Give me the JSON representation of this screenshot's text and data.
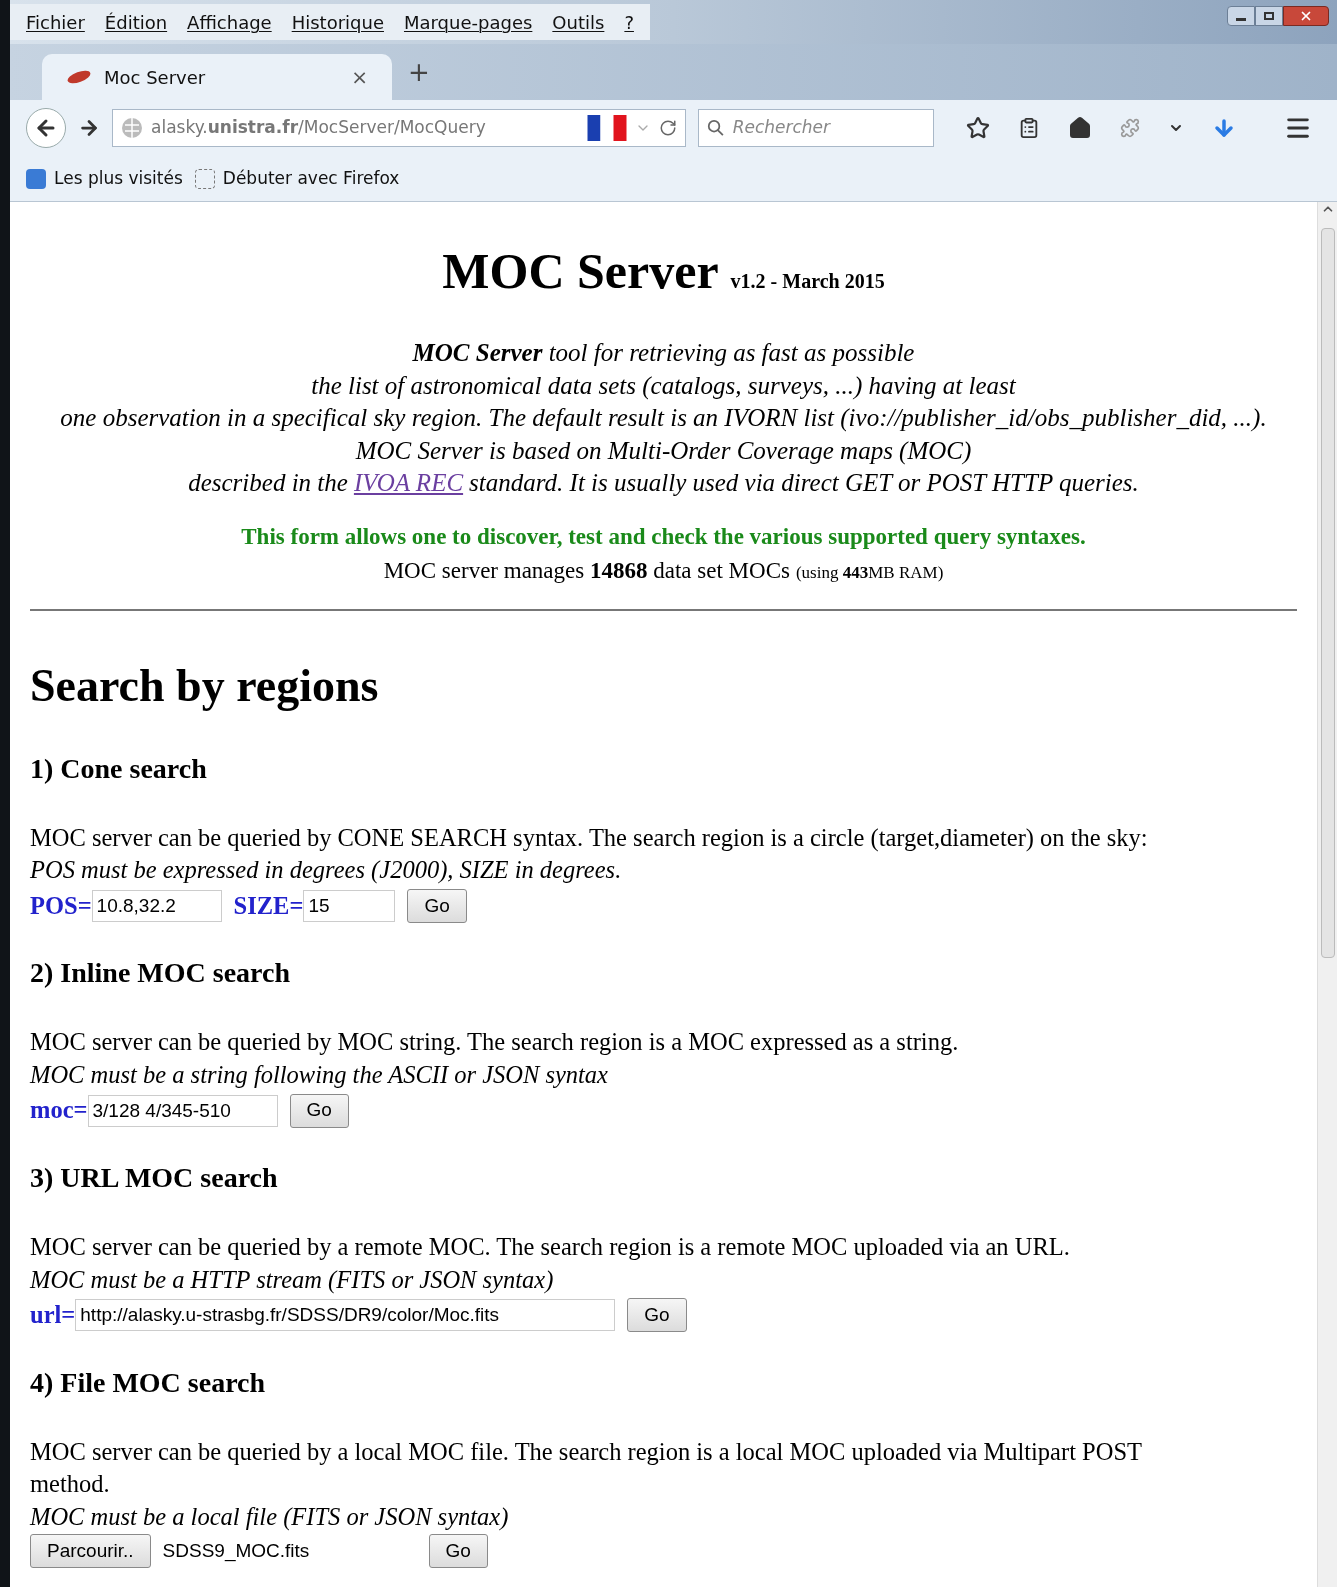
{
  "menu": [
    "Fichier",
    "Édition",
    "Affichage",
    "Historique",
    "Marque-pages",
    "Outils",
    "?"
  ],
  "tabs": [
    {
      "title": "Moc Server",
      "close": "×",
      "selected": true
    }
  ],
  "new_tab": "+",
  "url": "alasky.**unistra.fr**/MocServer/MocQuery",
  "search": {
    "placeholder": "Rechercher"
  },
  "bookmarks": [
    "Les plus visités",
    "Débuter avec Firefox"
  ],
  "page": {
    "title": "MOC Server",
    "version": "v1.2 - March 2015",
    "intro": [
      "**MOC Server** tool for retrieving as fast as possible",
      "the list of astronomical data sets (catalogs, surveys, ...) having at least",
      "one observation in a specifical sky region. The default result is an IVORN list (ivo://publisher_id/obs_publisher_did, ...).",
      "MOC Server is based on Multi-Order Coverage maps (MOC)"
    ],
    "intro_last": {
      "before": "described in the",
      "link": "IVOA REC",
      "after": "standard. It is usually used via direct GET or POST HTTP queries."
    },
    "notice": "This form allows one to discover, test and check the various supported query syntaxes.",
    "stats": "MOC server manages **14868** data set MOCs",
    "stats_note": "(using **443**MB RAM)",
    "heading": "Search by regions",
    "sections": [
      {
        "kind": "inputs",
        "title": "1) Cone search",
        "description": "MOC server can be queried by CONE SEARCH syntax. The search region is a circle (target,diameter) on the sky:",
        "hint": "POS must be expressed in degrees (J2000), SIZE in degrees.",
        "fields": [
          {
            "label": "POS=",
            "value": "10.8,32.2"
          },
          {
            "label": "SIZE=",
            "value": "15"
          }
        ],
        "button": "Go"
      },
      {
        "kind": "inputs",
        "title": "2) Inline MOC search",
        "description": "MOC server can be queried by MOC string. The search region is a MOC expressed as a string.",
        "hint": "MOC must be a string following the ASCII or JSON syntax",
        "fields": [
          {
            "label": "moc=",
            "value": "3/128 4/345-510"
          }
        ],
        "button": "Go"
      },
      {
        "kind": "inputs",
        "title": "3) URL MOC search",
        "description": "MOC server can be queried by a remote MOC. The search region is a remote MOC uploaded via an URL.",
        "hint": "MOC must be a HTTP stream (FITS or JSON syntax)",
        "fields": [
          {
            "label": "url=",
            "value": "http://alasky.u-strasbg.fr/SDSS/DR9/color/Moc.fits"
          }
        ],
        "button": "Go"
      },
      {
        "kind": "file",
        "title": "4) File MOC search",
        "description": "MOC server can be queried by a local MOC file. The search region is a local MOC uploaded via Multipart POST method.",
        "hint": "MOC must be a local file (FITS or JSON syntax)",
        "browse": "Parcourir..",
        "file": "SDSS9_MOC.fits",
        "button": "Go"
      }
    ]
  }
}
